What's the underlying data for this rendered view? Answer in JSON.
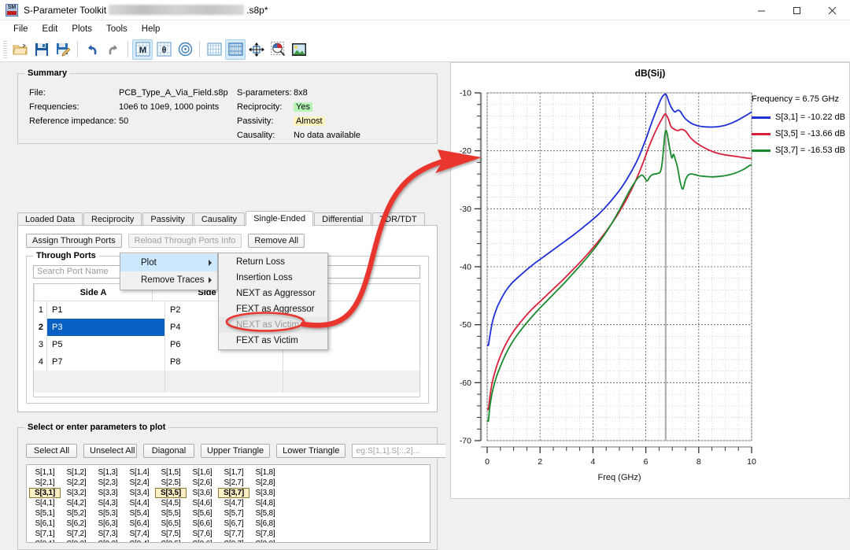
{
  "window": {
    "title_prefix": "S-Parameter Toolkit",
    "title_suffix": ".s8p*",
    "app_icon": "sparam-toolkit-icon",
    "minimize": "–",
    "maximize": "☐",
    "close": "✕"
  },
  "menubar": {
    "items": [
      "File",
      "Edit",
      "Plots",
      "Tools",
      "Help"
    ]
  },
  "toolbar": {
    "buttons": [
      {
        "name": "open-file-icon",
        "glyph": "open"
      },
      {
        "name": "save-icon",
        "glyph": "save"
      },
      {
        "name": "save-as-icon",
        "glyph": "save-as"
      },
      {
        "name": "undo-icon",
        "glyph": "undo"
      },
      {
        "name": "redo-icon",
        "glyph": "redo"
      },
      {
        "name": "magnitude-plot-icon",
        "glyph": "M",
        "active": true
      },
      {
        "name": "phase-plot-icon",
        "glyph": "θ",
        "active": false
      },
      {
        "name": "smith-chart-icon",
        "glyph": "smith",
        "active": false
      },
      {
        "name": "grid-linear-icon",
        "glyph": "grid1",
        "active": false
      },
      {
        "name": "grid-log-icon",
        "glyph": "grid2",
        "active": true
      },
      {
        "name": "pan-icon",
        "glyph": "pan"
      },
      {
        "name": "zoom-icon",
        "glyph": "zoom"
      },
      {
        "name": "export-image-icon",
        "glyph": "image"
      }
    ]
  },
  "summary": {
    "title": "Summary",
    "file_label": "File:",
    "file_value": "PCB_Type_A_Via_Field.s8p",
    "frequencies_label": "Frequencies:",
    "frequencies_value": "10e6 to 10e9, 1000 points",
    "impedance_label": "Reference impedance:",
    "impedance_value": "50",
    "sparams_label": "S-parameters:",
    "sparams_value": "8x8",
    "reciprocity_label": "Reciprocity:",
    "reciprocity_value": "Yes",
    "passivity_label": "Passivity:",
    "passivity_value": "Almost",
    "causality_label": "Causality:",
    "causality_value": "No data available"
  },
  "tabs": {
    "items": [
      "Loaded Data",
      "Reciprocity",
      "Passivity",
      "Causality",
      "Single-Ended",
      "Differential",
      "TDR/TDT"
    ],
    "selected": "Single-Ended"
  },
  "single_ended": {
    "assign_button": "Assign Through Ports",
    "reload_button": "Reload Through Ports Info",
    "remove_all_button": "Remove All",
    "through_ports_title": "Through Ports",
    "search_placeholder": "Search Port Name",
    "columns": [
      "Side A",
      "Side B"
    ],
    "rows": [
      {
        "n": "1",
        "side_a": "P1",
        "side_b": "P2",
        "selected": false
      },
      {
        "n": "2",
        "side_a": "P3",
        "side_b": "P4",
        "selected": true
      },
      {
        "n": "3",
        "side_a": "P5",
        "side_b": "P6",
        "selected": false
      },
      {
        "n": "4",
        "side_a": "P7",
        "side_b": "P8",
        "selected": false
      }
    ]
  },
  "context_menu": {
    "items": [
      {
        "label": "Plot",
        "submenu": true,
        "highlighted": true
      },
      {
        "label": "Remove Traces",
        "submenu": true,
        "highlighted": false
      }
    ],
    "submenu": [
      {
        "label": "Return Loss",
        "disabled": false
      },
      {
        "label": "Insertion Loss",
        "disabled": false
      },
      {
        "label": "NEXT as Aggressor",
        "disabled": false
      },
      {
        "label": "FEXT as Aggressor",
        "disabled": false
      },
      {
        "label": "NEXT as Victim",
        "disabled": true
      },
      {
        "label": "FEXT as Victim",
        "disabled": false
      }
    ]
  },
  "parameters": {
    "title": "Select or enter parameters to plot",
    "buttons": [
      "Select All",
      "Unselect All",
      "Diagonal",
      "Upper Triangle",
      "Lower Triangle"
    ],
    "entry_placeholder": "eg:S[1,1],S[::,2]...",
    "grid_size": 8,
    "selected_cells": [
      "S[3,1]",
      "S[3,5]",
      "S[3,7]"
    ]
  },
  "chart_data": {
    "type": "line",
    "title": "dB(Sij)",
    "xlabel": "Freq (GHz)",
    "ylabel": "",
    "xlim": [
      0,
      10
    ],
    "ylim": [
      -70,
      -10
    ],
    "xticks": [
      0,
      2,
      4,
      6,
      8,
      10
    ],
    "yticks": [
      -10,
      -20,
      -30,
      -40,
      -50,
      -60,
      -70
    ],
    "grid": true,
    "legend_position": "right",
    "legend_title": "Frequency = 6.75 GHz",
    "cursor_frequency_ghz": 6.75,
    "series": [
      {
        "name": "S[3,1]",
        "label": "S[3,1] = -10.22 dB",
        "value_at_cursor": -10.22,
        "color": "#2030d8",
        "x": [
          0.01,
          0.05,
          0.1,
          0.2,
          0.35,
          0.5,
          0.7,
          0.9,
          1.1,
          1.3,
          1.5,
          1.8,
          2.1,
          2.4,
          2.7,
          3.0,
          3.3,
          3.6,
          3.9,
          4.2,
          4.5,
          4.8,
          5.1,
          5.4,
          5.7,
          6.0,
          6.2,
          6.4,
          6.55,
          6.65,
          6.72,
          6.75,
          6.8,
          6.9,
          7.0,
          7.1,
          7.2,
          7.3,
          7.4,
          7.5,
          7.7,
          7.9,
          8.1,
          8.4,
          8.7,
          9.0,
          9.3,
          9.6,
          9.9,
          10.0
        ],
        "y": [
          -53.5,
          -53.5,
          -52.0,
          -49.5,
          -47.3,
          -45.8,
          -44.2,
          -43.0,
          -42.1,
          -41.3,
          -40.5,
          -39.4,
          -38.4,
          -37.4,
          -36.4,
          -35.4,
          -34.4,
          -33.3,
          -32.2,
          -31.0,
          -29.6,
          -28.0,
          -26.2,
          -24.0,
          -21.4,
          -18.0,
          -15.4,
          -13.0,
          -11.3,
          -10.5,
          -10.25,
          -10.22,
          -10.6,
          -11.9,
          -12.8,
          -13.3,
          -13.0,
          -13.2,
          -13.9,
          -14.5,
          -15.2,
          -15.6,
          -15.8,
          -15.9,
          -15.85,
          -15.6,
          -15.1,
          -14.4,
          -13.6,
          -13.3
        ]
      },
      {
        "name": "S[3,5]",
        "label": "S[3,5] = -13.66 dB",
        "value_at_cursor": -13.66,
        "color": "#d8203c",
        "x": [
          0.01,
          0.05,
          0.1,
          0.2,
          0.35,
          0.5,
          0.7,
          0.9,
          1.1,
          1.4,
          1.7,
          2.0,
          2.3,
          2.6,
          2.9,
          3.2,
          3.5,
          3.8,
          4.1,
          4.4,
          4.7,
          5.0,
          5.3,
          5.6,
          5.9,
          6.1,
          6.3,
          6.5,
          6.62,
          6.7,
          6.75,
          6.85,
          6.95,
          7.05,
          7.2,
          7.35,
          7.5,
          7.6,
          7.7,
          7.9,
          8.1,
          8.4,
          8.7,
          9.0,
          9.3,
          9.6,
          9.9,
          10.0
        ],
        "y": [
          -64.5,
          -64.5,
          -62.5,
          -59.8,
          -57.3,
          -55.4,
          -53.4,
          -51.8,
          -50.5,
          -48.8,
          -47.3,
          -46.0,
          -44.7,
          -43.4,
          -42.1,
          -40.7,
          -39.3,
          -37.8,
          -36.2,
          -34.5,
          -32.6,
          -30.5,
          -28.1,
          -25.3,
          -22.0,
          -19.5,
          -17.3,
          -15.4,
          -14.4,
          -13.8,
          -13.66,
          -14.5,
          -15.8,
          -16.2,
          -16.5,
          -16.3,
          -16.6,
          -17.2,
          -17.8,
          -18.6,
          -19.2,
          -19.9,
          -20.4,
          -20.7,
          -20.9,
          -21.1,
          -21.3,
          -21.3
        ]
      },
      {
        "name": "S[3,7]",
        "label": "S[3,7] = -16.53 dB",
        "value_at_cursor": -16.53,
        "color": "#1a8a2e",
        "x": [
          0.01,
          0.05,
          0.1,
          0.2,
          0.35,
          0.5,
          0.7,
          0.9,
          1.1,
          1.4,
          1.7,
          2.0,
          2.3,
          2.6,
          2.9,
          3.2,
          3.5,
          3.8,
          4.1,
          4.4,
          4.7,
          5.0,
          5.3,
          5.5,
          5.7,
          5.85,
          5.95,
          6.05,
          6.15,
          6.25,
          6.35,
          6.45,
          6.55,
          6.62,
          6.68,
          6.72,
          6.75,
          6.8,
          6.9,
          6.98,
          7.05,
          7.12,
          7.2,
          7.3,
          7.4,
          7.5,
          7.6,
          7.7,
          7.85,
          8.0,
          8.2,
          8.5,
          8.8,
          9.1,
          9.4,
          9.7,
          9.9,
          10.0
        ],
        "y": [
          -66.5,
          -66.5,
          -64.2,
          -61.5,
          -59.0,
          -57.2,
          -55.1,
          -53.4,
          -52.0,
          -50.2,
          -48.6,
          -47.1,
          -45.7,
          -44.3,
          -42.9,
          -41.4,
          -39.9,
          -38.3,
          -36.6,
          -34.7,
          -32.6,
          -30.2,
          -27.6,
          -26.0,
          -24.7,
          -24.2,
          -24.6,
          -25.2,
          -24.5,
          -24.1,
          -24.0,
          -23.9,
          -23.6,
          -22.0,
          -19.0,
          -17.2,
          -16.53,
          -16.9,
          -19.5,
          -21.2,
          -20.6,
          -21.6,
          -22.9,
          -25.4,
          -26.6,
          -25.0,
          -24.2,
          -24.0,
          -24.1,
          -24.3,
          -24.4,
          -24.5,
          -24.4,
          -24.2,
          -23.8,
          -23.2,
          -22.6,
          -22.4
        ]
      }
    ]
  },
  "annotation": {
    "color": "#e8352e",
    "ellipse_target": "NEXT as Victim",
    "arrow_description": "curved arrow from menu item to chart"
  }
}
